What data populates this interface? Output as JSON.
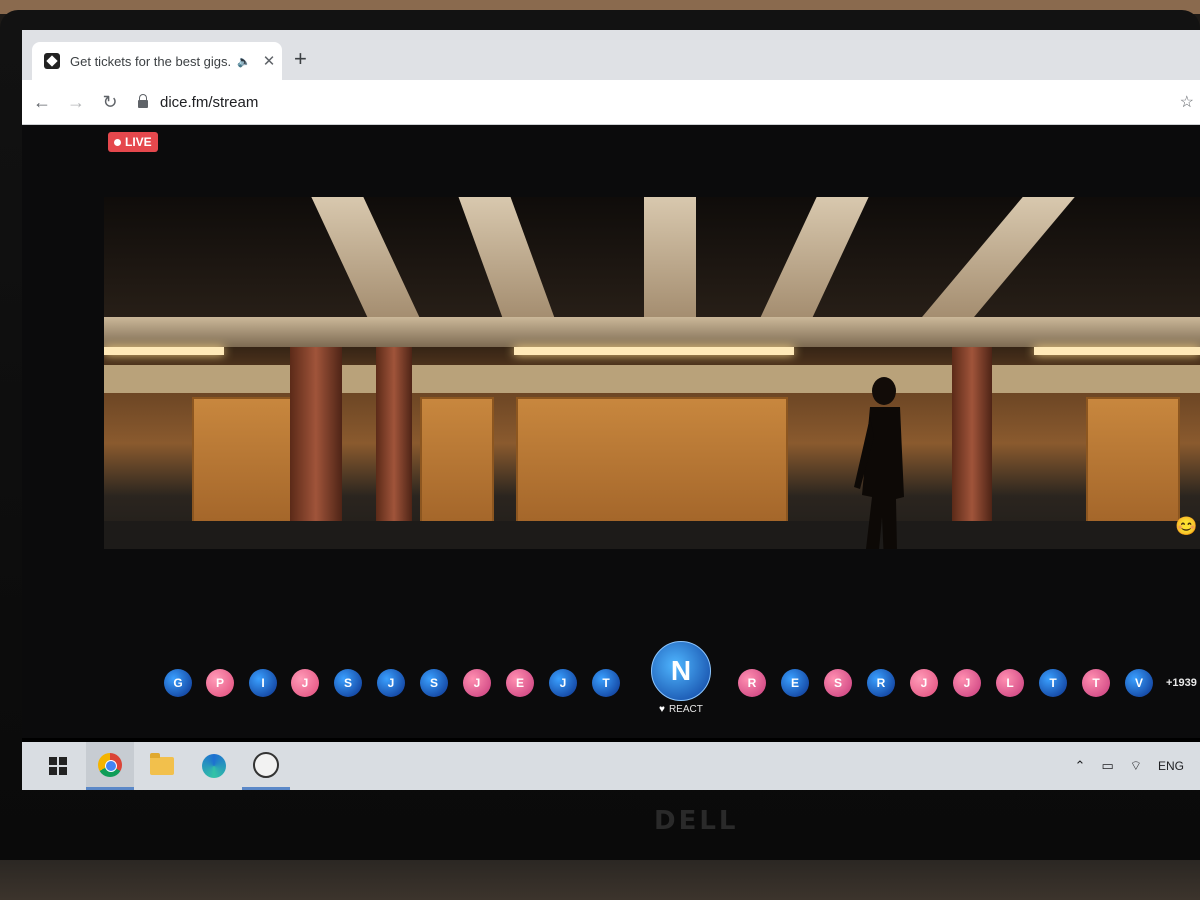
{
  "browser": {
    "tab_title": "Get tickets for the best gigs.",
    "tab_audio_icon": "speaker-icon",
    "close_icon": "close-icon",
    "new_tab_label": "+",
    "url": "dice.fm/stream",
    "nav": {
      "back": "←",
      "forward": "→",
      "reload": "↻"
    },
    "bookmark_icon": "☆"
  },
  "stream": {
    "live_label": "LIVE",
    "viewers": [
      {
        "initial": "G",
        "style": "b"
      },
      {
        "initial": "P",
        "style": "p"
      },
      {
        "initial": "I",
        "style": "b"
      },
      {
        "initial": "J",
        "style": "p"
      },
      {
        "initial": "S",
        "style": "b"
      },
      {
        "initial": "J",
        "style": "b"
      },
      {
        "initial": "S",
        "style": "b"
      },
      {
        "initial": "J",
        "style": "r"
      },
      {
        "initial": "E",
        "style": "r"
      },
      {
        "initial": "J",
        "style": "b"
      },
      {
        "initial": "T",
        "style": "b"
      },
      {
        "initial": "R",
        "style": "r"
      },
      {
        "initial": "E",
        "style": "b"
      },
      {
        "initial": "S",
        "style": "r"
      },
      {
        "initial": "R",
        "style": "b"
      },
      {
        "initial": "J",
        "style": "p"
      },
      {
        "initial": "J",
        "style": "r"
      },
      {
        "initial": "L",
        "style": "r"
      },
      {
        "initial": "T",
        "style": "b"
      },
      {
        "initial": "T",
        "style": "r"
      },
      {
        "initial": "V",
        "style": "b"
      }
    ],
    "main_initial": "N",
    "react_label": "REACT",
    "react_icon": "♥",
    "viewer_count": "+1939",
    "emoji": "😊"
  },
  "taskbar": {
    "items": [
      "windows-start-icon",
      "chrome-icon",
      "file-explorer-icon",
      "edge-icon",
      "dice-app-icon"
    ],
    "tray_arrow": "⌃",
    "tray_battery": "▭",
    "tray_wifi": "wifi",
    "lang": "ENG"
  },
  "device_brand": "DELL"
}
